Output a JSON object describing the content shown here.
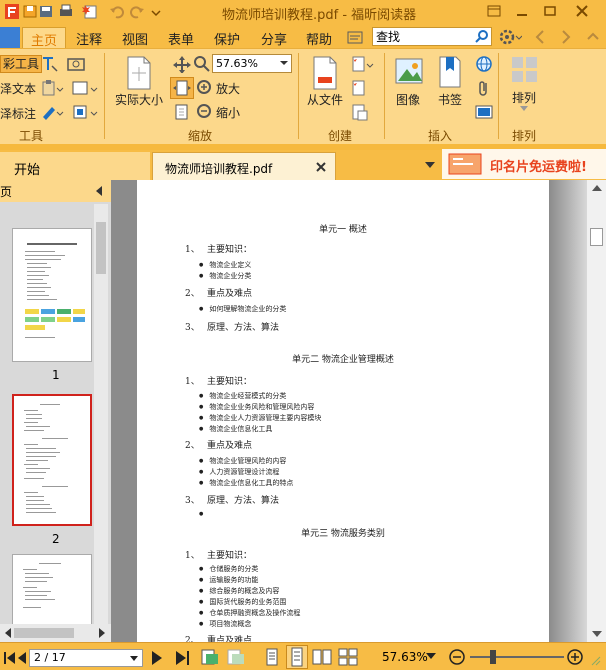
{
  "window": {
    "title": "物流师培训教程.pdf - 福昕阅读器"
  },
  "menu_tabs": [
    "主页",
    "注释",
    "视图",
    "表单",
    "保护",
    "分享",
    "帮助"
  ],
  "active_tab": "主页",
  "search": {
    "value": "查找"
  },
  "ribbon": {
    "tools_group": {
      "label": "工具",
      "items": [
        "彩工具",
        "泽文本",
        "泽标注"
      ]
    },
    "zoom_group": {
      "label": "缩放",
      "actual_size": "实际大小",
      "zoom_value": "57.63%",
      "zoom_in": "放大",
      "zoom_out": "缩小"
    },
    "create_group": {
      "label": "创建",
      "from_file": "从文件"
    },
    "insert_group": {
      "label": "插入",
      "image": "图像",
      "bookmark": "书签"
    },
    "arrange_group": {
      "label": "排列",
      "arrange": "排列"
    }
  },
  "doc_tabs": {
    "start": "开始",
    "current": "物流师培训教程.pdf"
  },
  "ad": {
    "text": "印名片免运费啦!"
  },
  "left_panel": {
    "header": "页",
    "thumbs": [
      "1",
      "2"
    ],
    "selected": "2"
  },
  "document": {
    "units": [
      {
        "title": "单元一  概述",
        "sections": [
          {
            "num": "1、",
            "title": "主要知识：",
            "bullets": [
              "物流企业定义",
              "物流企业分类"
            ]
          },
          {
            "num": "2、",
            "title": "重点及难点",
            "bullets": [
              "如何理解物流企业的分类"
            ]
          },
          {
            "num": "3、",
            "title": "原理、方法、算法",
            "bullets": []
          }
        ]
      },
      {
        "title": "单元二    物流企业管理概述",
        "sections": [
          {
            "num": "1、",
            "title": "主要知识：",
            "bullets": [
              "物流企业经营模式的分类",
              "物流企业业务风险和管理风险内容",
              "物流企业人力资源管理主要内容模块",
              "物流企业信息化工具"
            ]
          },
          {
            "num": "2、",
            "title": "重点及难点",
            "bullets": [
              "物流企业管理风险的内容",
              "人力资源管理设计流程",
              "物流企业信息化工具的特点"
            ]
          },
          {
            "num": "3、",
            "title": "原理、方法、算法",
            "bullets": [
              ""
            ]
          }
        ]
      },
      {
        "title": "单元三    物流服务类别",
        "sections": [
          {
            "num": "1、",
            "title": "主要知识：",
            "bullets": [
              "仓储服务的分类",
              "运输服务的功能",
              "综合服务的概念及内容",
              "国际货代服务的业务范围",
              "仓单质押融资概念及操作流程",
              "项目物流概念"
            ]
          },
          {
            "num": "2、",
            "title": "重点及难点",
            "bullets": []
          }
        ]
      }
    ]
  },
  "status": {
    "page_indicator": "2 / 17",
    "zoom": "57.63%"
  },
  "colors": {
    "titlebar": "#f7bc45",
    "ribbon": "#fcd88b",
    "accent": "#e07b00",
    "ad_red": "#e8431e"
  }
}
